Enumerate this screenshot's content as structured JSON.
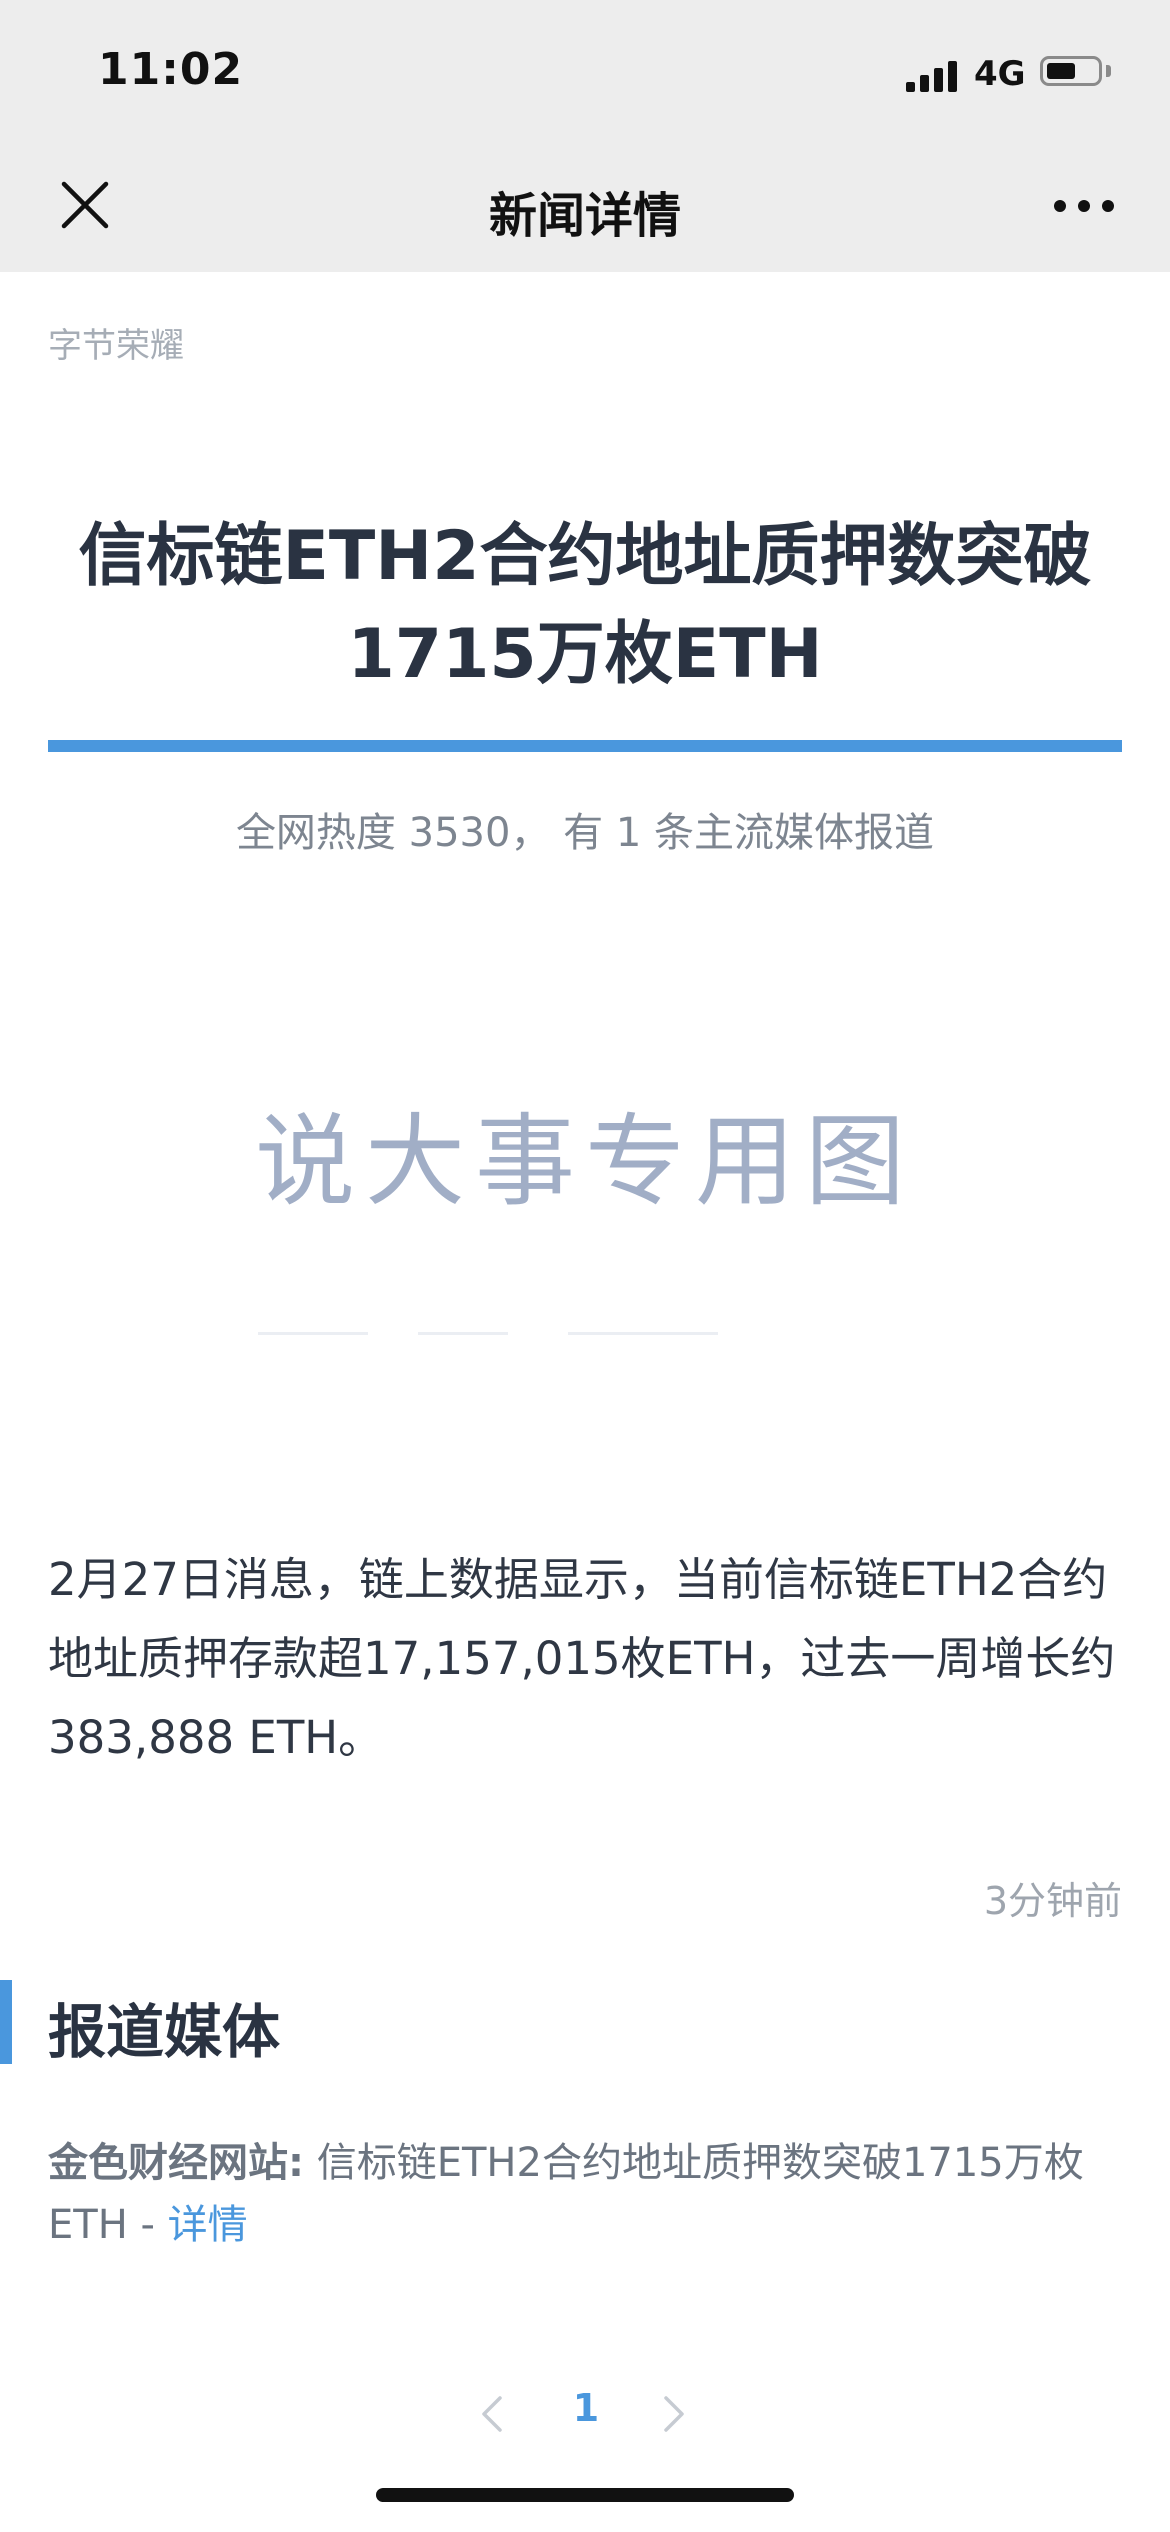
{
  "status_bar": {
    "time": "11:02",
    "network": "4G",
    "battery_level": 0.55
  },
  "nav": {
    "title": "新闻详情",
    "close_icon": "close-icon",
    "more_icon": "more-icon"
  },
  "article": {
    "source": "字节荣耀",
    "headline_line1": "信标链ETH2合约地址质押数突破",
    "headline_line2": "1715万枚ETH",
    "heat_text": "全网热度 3530， 有 1 条主流媒体报道",
    "image_text": "说大事专用图",
    "body": "2月27日消息，链上数据显示，当前信标链ETH2合约地址质押存款超17,157,015枚ETH，过去一周增长约383,888 ETH。",
    "time_ago": "3分钟前"
  },
  "media_section": {
    "title": "报道媒体",
    "items": [
      {
        "name": "金色财经网站:",
        "text": " 信标链ETH2合约地址质押数突破1715万枚ETH - ",
        "link": "详情"
      }
    ]
  },
  "pagination": {
    "current_page": "1"
  },
  "colors": {
    "accent": "#4a97dd",
    "nav_bg": "#ededed",
    "headline": "#2a3342"
  }
}
